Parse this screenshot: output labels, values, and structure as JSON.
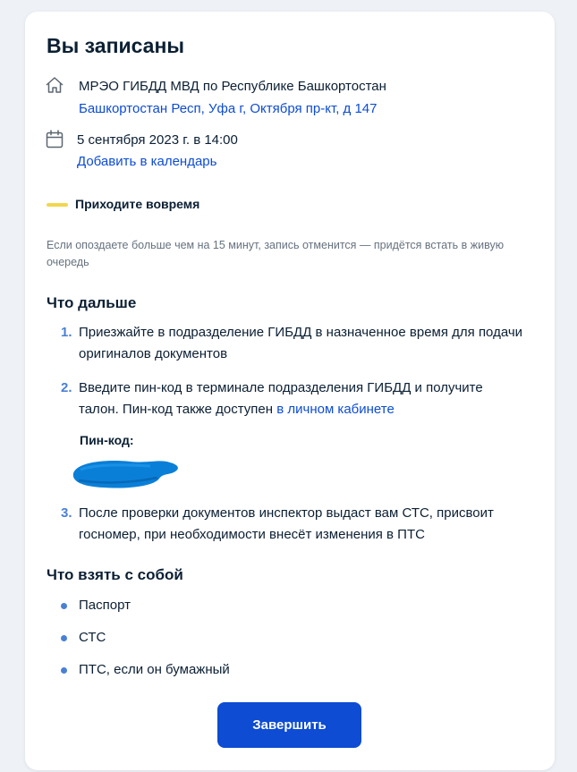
{
  "title": "Вы записаны",
  "location": {
    "icon": "home-icon",
    "name": "МРЭО ГИБДД МВД по Республике Башкортостан",
    "address": "Башкортостан Респ, Уфа г, Октября пр-кт, д 147"
  },
  "appointment": {
    "icon": "calendar-icon",
    "datetime": "5 сентября 2023 г. в 14:00",
    "add_to_calendar": "Добавить в календарь"
  },
  "warning": {
    "title": "Приходите вовремя",
    "note": "Если опоздаете больше чем на 15 минут, запись отменится — придётся встать в живую очередь",
    "accent_color": "#f2d74e"
  },
  "next_steps": {
    "heading": "Что дальше",
    "items": [
      {
        "num": "1.",
        "text": "Приезжайте в подразделение ГИБДД в назначенное время для подачи оригиналов документов"
      },
      {
        "num": "2.",
        "text_before": "Введите пин-код в терминале подразделения ГИБДД и получите талон. Пин-код также доступен ",
        "link": "в личном кабинете"
      },
      {
        "num": "3.",
        "text": "После проверки документов инспектор выдаст вам СТС, присвоит госномер, при необходимости внесёт изменения в ПТС"
      }
    ],
    "pin_label": "Пин-код:"
  },
  "bring": {
    "heading": "Что взять с собой",
    "items": [
      "Паспорт",
      "СТС",
      "ПТС, если он бумажный"
    ]
  },
  "finish_button": "Завершить",
  "colors": {
    "primary": "#0d4cd3",
    "text": "#0b1f33",
    "muted": "#66727f",
    "step_number": "#4a80d4",
    "background": "#eef1f6"
  }
}
